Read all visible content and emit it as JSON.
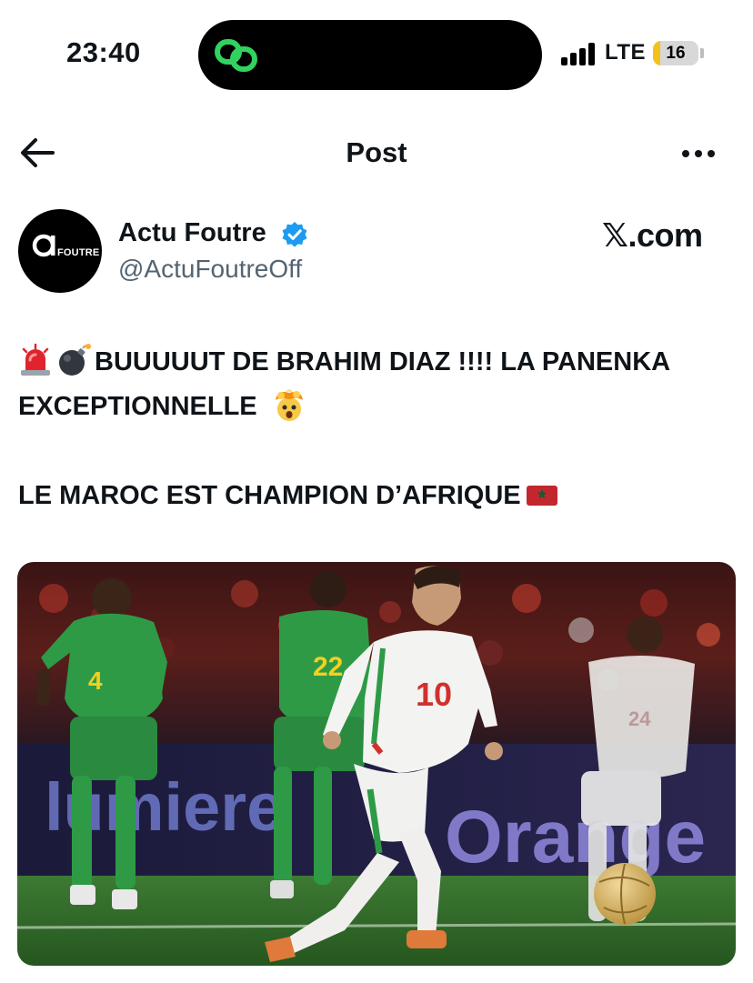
{
  "status_bar": {
    "time": "23:40",
    "network": "LTE",
    "battery": "16",
    "battery_level": 0.16
  },
  "header": {
    "title": "Post"
  },
  "author": {
    "avatar_word": "FOUTRE",
    "name": "Actu Foutre",
    "handle": "@ActuFoutreOff",
    "source": "𝕏.com"
  },
  "tweet": {
    "line1": "BUUUUUT DE BRAHIM DIAZ !!!! LA PANENKA EXCEPTIONNELLE",
    "line2": "LE MAROC EST CHAMPION D’AFRIQUE"
  },
  "photo": {
    "jersey_left": "4",
    "jersey_mid": "22",
    "jersey_main": "10",
    "jersey_right": "24",
    "board_left": "lumiere",
    "board_right": "Orange"
  },
  "colors": {
    "senegal_green": "#2e9a46",
    "morocco_white": "#f3f3f1",
    "morocco_red": "#d0312d",
    "pitch": "#2f6b2a",
    "verified_blue": "#1d9bf0",
    "accent_green": "#31d35e"
  }
}
